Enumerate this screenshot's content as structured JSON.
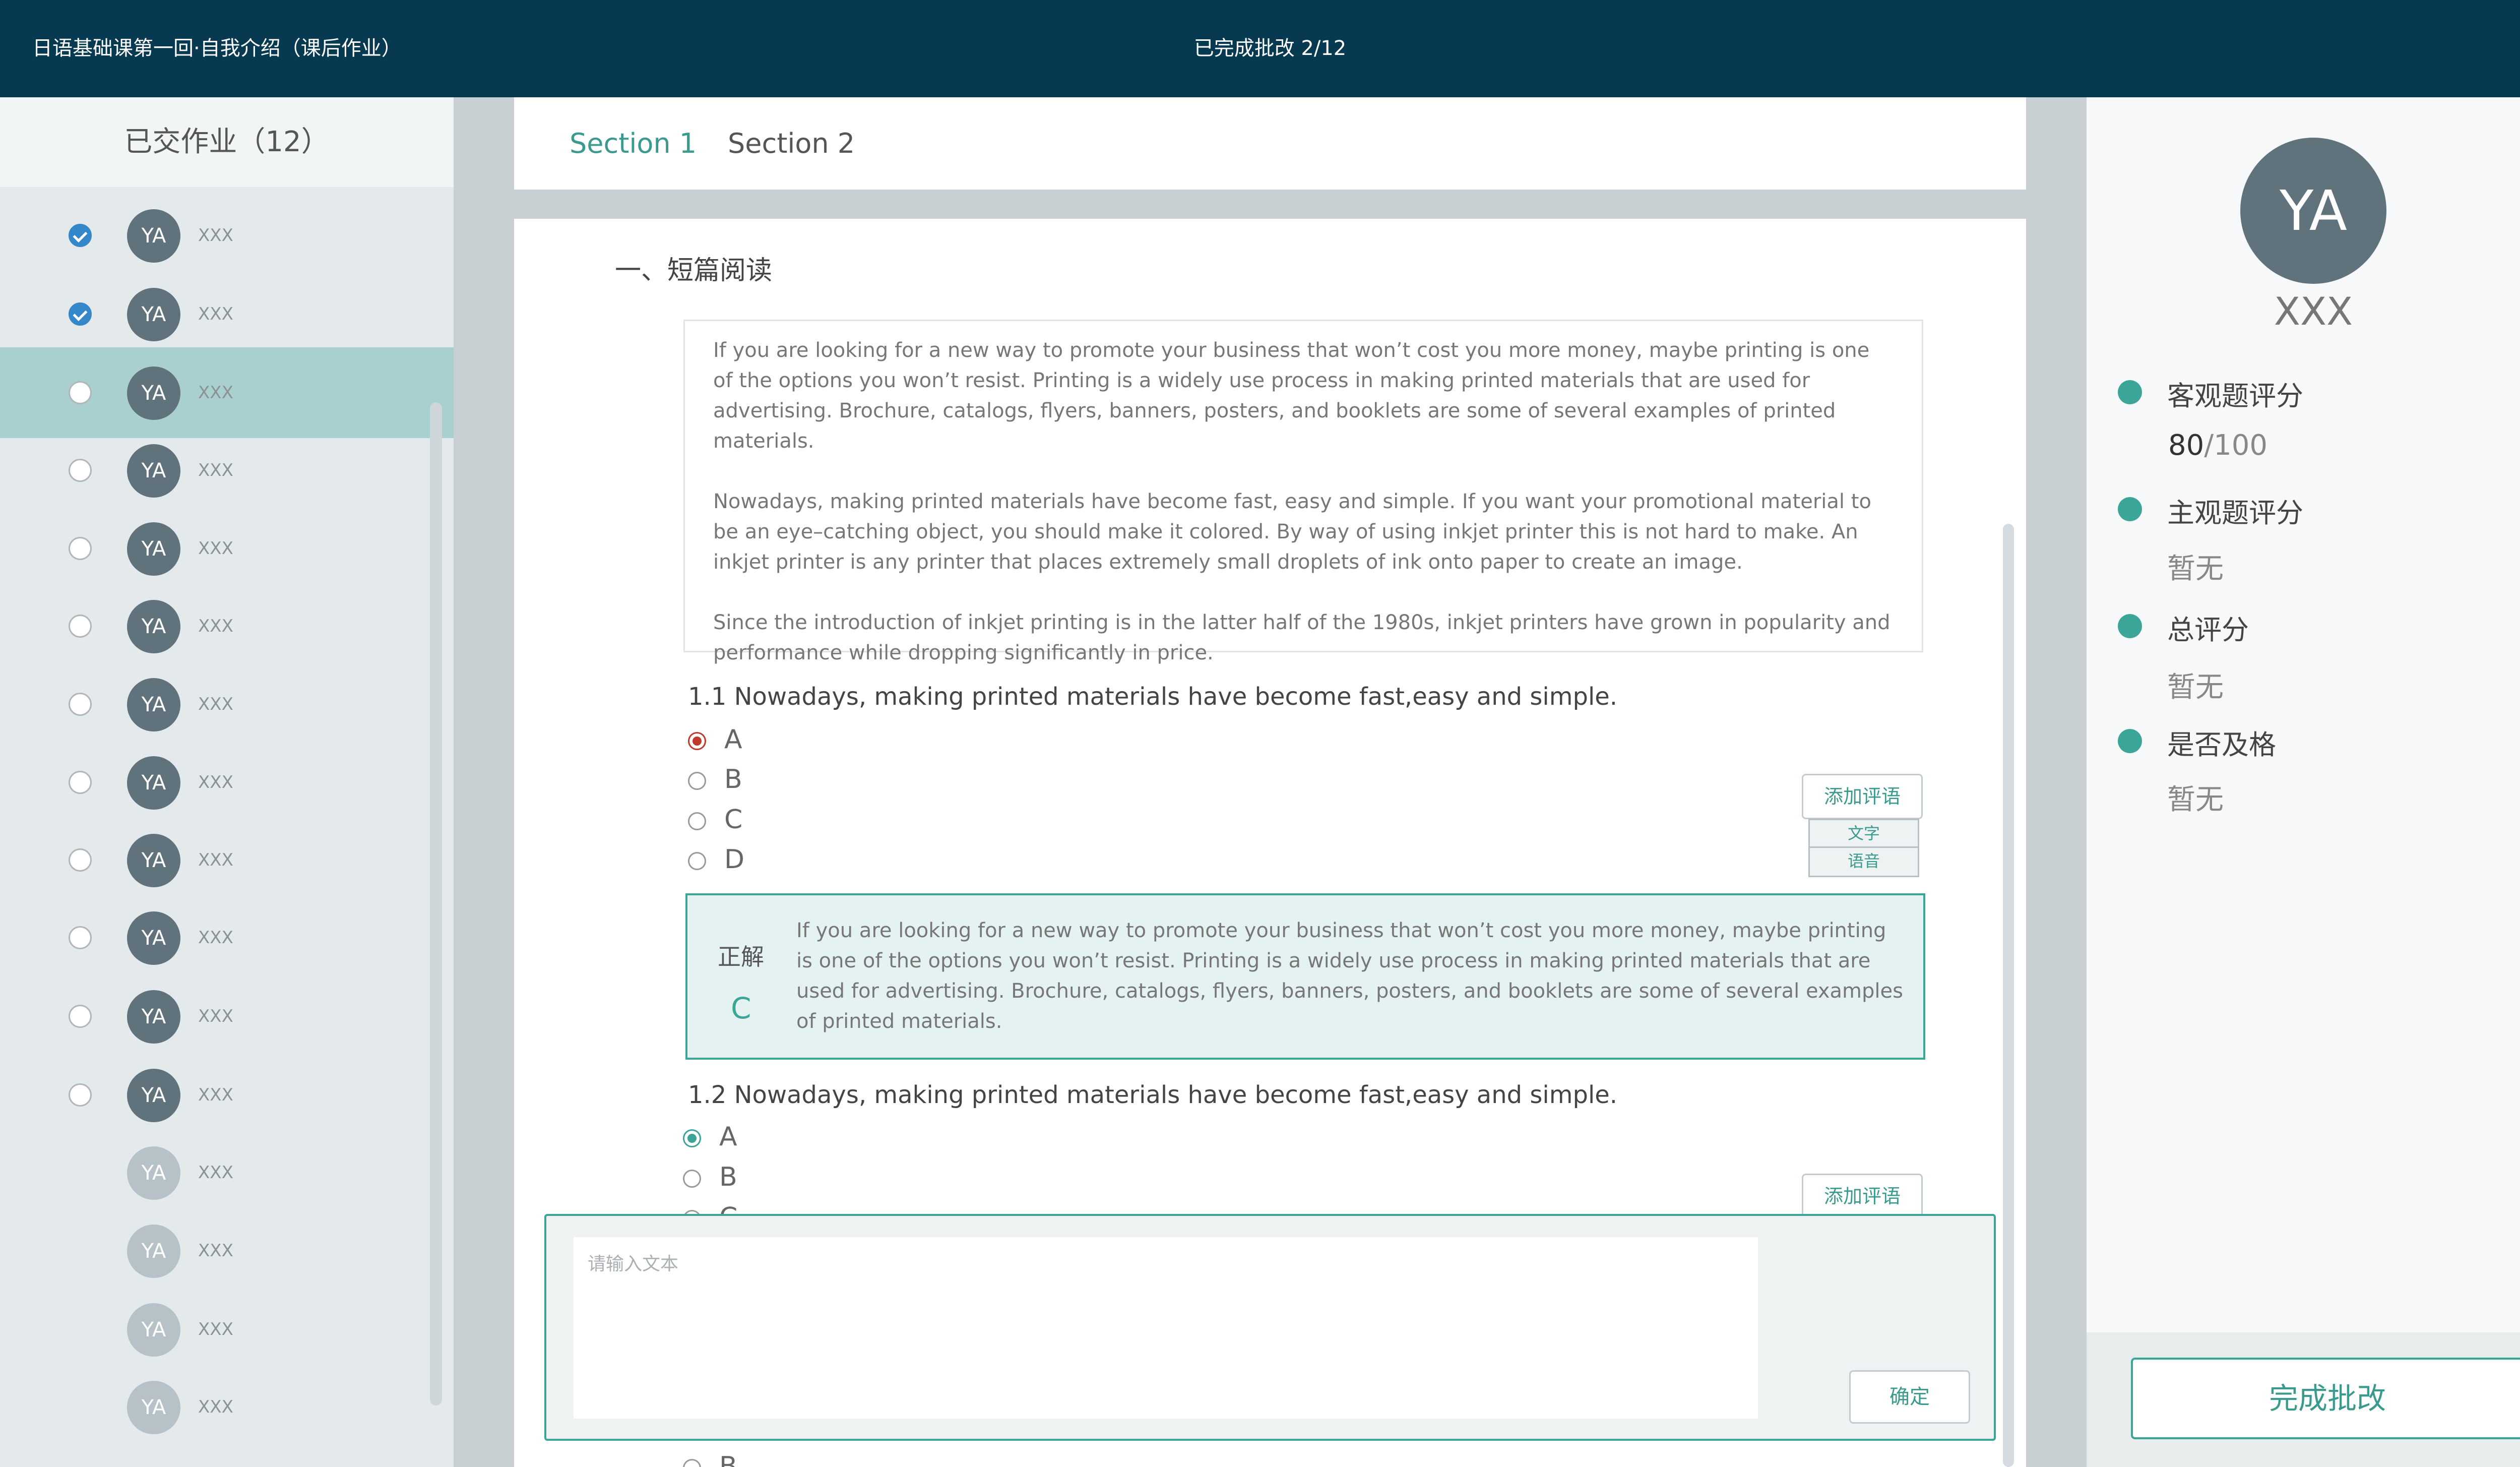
{
  "header": {
    "title": "日语基础课第一回·自我介绍（课后作业）",
    "progress": "已完成批改 2/12"
  },
  "sidebar": {
    "title": "已交作业（12）",
    "students": [
      {
        "initials": "YA",
        "name": "XXX",
        "checked": true
      },
      {
        "initials": "YA",
        "name": "XXX",
        "checked": true
      },
      {
        "initials": "YA",
        "name": "XXX",
        "checked": false,
        "selected": true
      },
      {
        "initials": "YA",
        "name": "XXX",
        "checked": false
      },
      {
        "initials": "YA",
        "name": "XXX",
        "checked": false
      },
      {
        "initials": "YA",
        "name": "XXX",
        "checked": false
      },
      {
        "initials": "YA",
        "name": "XXX",
        "checked": false
      },
      {
        "initials": "YA",
        "name": "XXX",
        "checked": false
      },
      {
        "initials": "YA",
        "name": "XXX",
        "checked": false
      },
      {
        "initials": "YA",
        "name": "XXX",
        "checked": false
      },
      {
        "initials": "YA",
        "name": "XXX",
        "checked": false
      },
      {
        "initials": "YA",
        "name": "XXX",
        "checked": false
      },
      {
        "initials": "YA",
        "name": "XXX",
        "submitted": false
      },
      {
        "initials": "YA",
        "name": "XXX",
        "submitted": false
      },
      {
        "initials": "YA",
        "name": "XXX",
        "submitted": false
      },
      {
        "initials": "YA",
        "name": "XXX",
        "submitted": false
      }
    ]
  },
  "tabs": [
    {
      "label": "Section 1",
      "active": true
    },
    {
      "label": "Section 2",
      "active": false
    }
  ],
  "section": {
    "title": "一、短篇阅读",
    "passage": [
      "If you are looking for a new way to promote your business that won’t cost you more money, maybe printing is one of the options you won’t resist. Printing is a widely use process in making printed materials that are used for advertising. Brochure, catalogs, flyers, banners, posters, and booklets are some of several examples of printed materials.",
      "Nowadays, making printed materials have become fast, easy and simple. If you want your promotional material to be an eye–catching object, you should make it colored. By way of using inkjet printer this is not hard to make. An inkjet printer is any printer that places extremely small droplets of ink onto paper to create an image.",
      "Since the introduction of inkjet printing is in the latter half of the 1980s, inkjet printers have grown in popularity and performance while dropping significantly in price."
    ]
  },
  "questions": [
    {
      "text": "1.1 Nowadays, making printed materials have become fast,easy and simple.",
      "options": [
        "A",
        "B",
        "C",
        "D"
      ],
      "selected": "A",
      "answer_tag": "正解",
      "answer_letter": "C",
      "explanation": "If you are looking for a new way to promote your business that won’t cost you more money, maybe printing is one of the options you won’t resist. Printing is a widely use process in making printed materials that are used for advertising. Brochure, catalogs, flyers, banners, posters, and booklets are some of several examples of printed materials."
    },
    {
      "text": "1.2 Nowadays, making printed materials have become fast,easy and simple.",
      "options": [
        "A",
        "B",
        "C"
      ],
      "selected": "A"
    }
  ],
  "partial_option_label": "B",
  "comment_button": "添加评语",
  "comment_menu": [
    "文字",
    "语音"
  ],
  "editor": {
    "placeholder": "请输入文本",
    "confirm": "确定"
  },
  "profile": {
    "initials": "YA",
    "name": "XXX"
  },
  "scores": [
    {
      "label": "客观题评分",
      "value": "80",
      "total": "/100"
    },
    {
      "label": "主观题评分",
      "value": "暂无"
    },
    {
      "label": "总评分",
      "value": "暂无"
    },
    {
      "label": "是否及格",
      "value": "暂无"
    }
  ],
  "finish_button": "完成批改",
  "colors": {
    "header": "#073a51",
    "accent": "#3ba698",
    "selected_row": "#a9cfcf",
    "check": "#3487c8",
    "wrong": "#c0392b"
  }
}
